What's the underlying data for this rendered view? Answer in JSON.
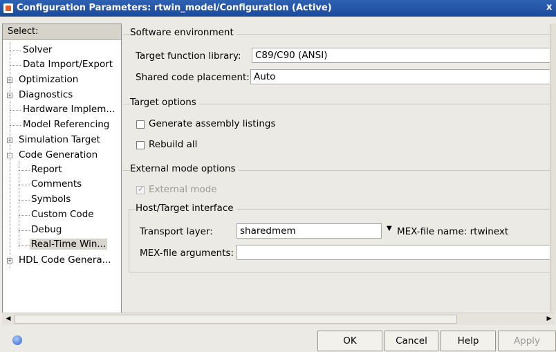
{
  "window": {
    "title": "Configuration Parameters: rtwin_model/Configuration (Active)",
    "close": "x"
  },
  "tree": {
    "header": "Select:",
    "items": [
      {
        "label": "Solver"
      },
      {
        "label": "Data Import/Export"
      },
      {
        "label": "Optimization",
        "expander": "+"
      },
      {
        "label": "Diagnostics",
        "expander": "+"
      },
      {
        "label": "Hardware Implem..."
      },
      {
        "label": "Model Referencing"
      },
      {
        "label": "Simulation Target",
        "expander": "+"
      },
      {
        "label": "Code Generation",
        "expander": "-"
      },
      {
        "label": "Report"
      },
      {
        "label": "Comments"
      },
      {
        "label": "Symbols"
      },
      {
        "label": "Custom Code"
      },
      {
        "label": "Debug"
      },
      {
        "label": "Real-Time Win...",
        "selected": true
      },
      {
        "label": "HDL Code Genera...",
        "expander": "+"
      }
    ]
  },
  "software_env": {
    "title": "Software environment",
    "target_label": "Target function library:",
    "target_value": "C89/C90 (ANSI)",
    "shared_label": "Shared code placement:",
    "shared_value": "Auto"
  },
  "target_options": {
    "title": "Target options",
    "assembly_label": "Generate assembly listings",
    "rebuild_label": "Rebuild all"
  },
  "external_mode": {
    "title": "External mode options",
    "external_label": "External mode",
    "host_title": "Host/Target interface",
    "transport_label": "Transport layer:",
    "transport_value": "sharedmem",
    "mex_name_label": "MEX-file name: rtwinext",
    "mex_args_label": "MEX-file arguments:",
    "mex_args_value": ""
  },
  "buttons": {
    "ok": "OK",
    "cancel": "Cancel",
    "help": "Help",
    "apply": "Apply"
  }
}
